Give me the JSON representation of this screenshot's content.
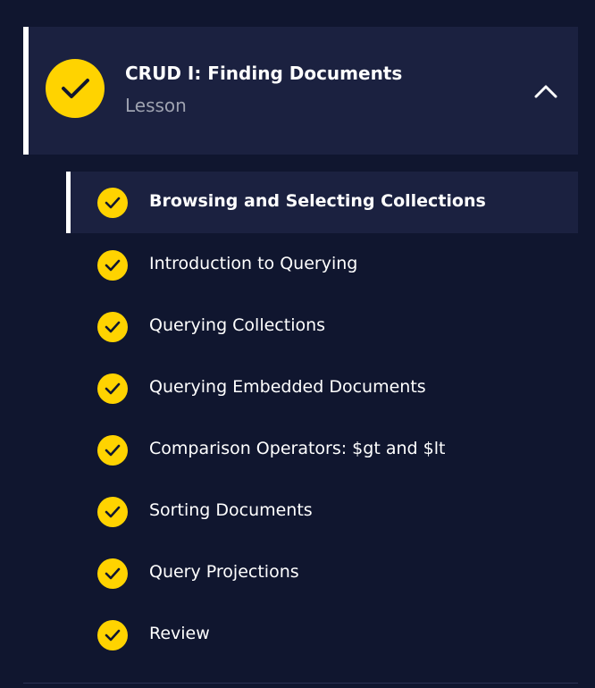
{
  "lesson": {
    "title": "CRUD I: Finding Documents",
    "type_label": "Lesson",
    "completed": true,
    "expanded": true
  },
  "items": [
    {
      "label": "Browsing and Selecting Collections",
      "completed": true,
      "active": true
    },
    {
      "label": "Introduction to Querying",
      "completed": true,
      "active": false
    },
    {
      "label": "Querying Collections",
      "completed": true,
      "active": false
    },
    {
      "label": "Querying Embedded Documents",
      "completed": true,
      "active": false
    },
    {
      "label": "Comparison Operators: $gt and $lt",
      "completed": true,
      "active": false
    },
    {
      "label": "Sorting Documents",
      "completed": true,
      "active": false
    },
    {
      "label": "Query Projections",
      "completed": true,
      "active": false
    },
    {
      "label": "Review",
      "completed": true,
      "active": false
    }
  ],
  "icons": {
    "check": "check-icon",
    "collapse": "chevron-up-icon"
  },
  "colors": {
    "background": "#10162f",
    "panel": "#1b2140",
    "accent": "#ffd300",
    "text": "#ffffff",
    "muted_text": "#9ea2b0"
  }
}
